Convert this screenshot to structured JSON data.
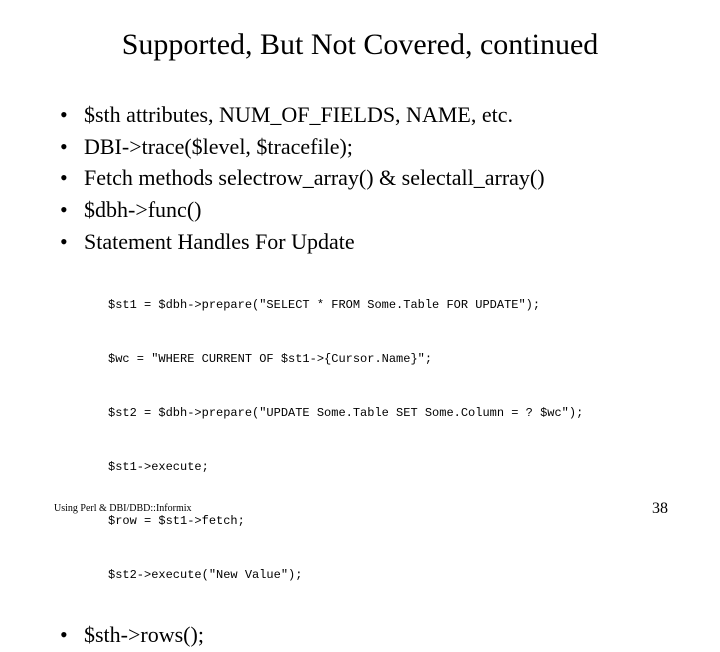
{
  "title": "Supported, But Not Covered, continued",
  "bullets": [
    "$sth attributes, NUM_OF_FIELDS, NAME, etc.",
    "DBI->trace($level, $tracefile);",
    "Fetch methods selectrow_array() & selectall_array()",
    "$dbh->func()",
    "Statement Handles For Update"
  ],
  "code_lines": [
    "$st1 = $dbh->prepare(\"SELECT * FROM Some.Table FOR UPDATE\");",
    "$wc = \"WHERE CURRENT OF $st1->{Cursor.Name}\";",
    "$st2 = $dbh->prepare(\"UPDATE Some.Table SET Some.Column = ? $wc\");",
    "$st1->execute;",
    "$row = $st1->fetch;",
    "$st2->execute(\"New Value\");"
  ],
  "bullet_after_code": "$sth->rows();",
  "footer_left": "Using Perl & DBI/DBD::Informix",
  "page_number": "38"
}
